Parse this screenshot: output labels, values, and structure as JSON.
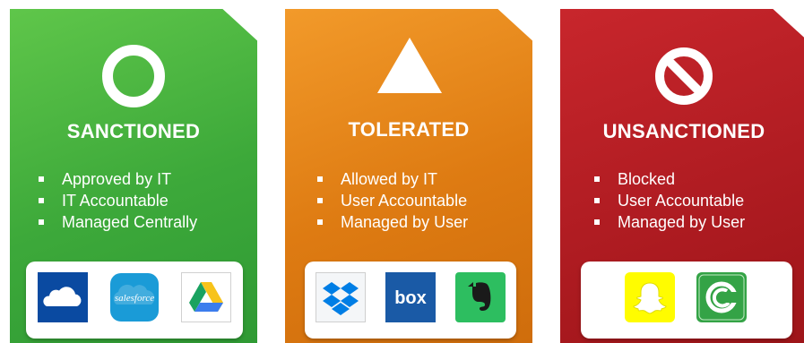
{
  "columns": [
    {
      "title": "SANCTIONED",
      "bullets": [
        "Approved by IT",
        "IT Accountable",
        "Managed Centrally"
      ],
      "color": "#3da93a",
      "symbol": "circle-icon",
      "apps": [
        {
          "icon": "onedrive-icon",
          "color": "#0a4aa1"
        },
        {
          "icon": "salesforce-icon",
          "color": "#1a9bd7",
          "label": "salesforce"
        },
        {
          "icon": "google-drive-icon",
          "color": "#ffffff"
        }
      ]
    },
    {
      "title": "TOLERATED",
      "bullets": [
        "Allowed by IT",
        "User Accountable",
        "Managed by User"
      ],
      "color": "#de7b12",
      "symbol": "triangle-icon",
      "apps": [
        {
          "icon": "dropbox-icon",
          "color": "#007ee5"
        },
        {
          "icon": "box-icon",
          "color": "#1a5aa6",
          "label": "box"
        },
        {
          "icon": "evernote-icon",
          "color": "#2dbe60"
        }
      ]
    },
    {
      "title": "UNSANCTIONED",
      "bullets": [
        "Blocked",
        "User Accountable",
        "Managed by User"
      ],
      "color": "#b01c22",
      "symbol": "prohibited-icon",
      "apps": [
        {
          "icon": "snapchat-icon",
          "color": "#fffc00"
        },
        {
          "icon": "bittorrent-icon",
          "color": "#34a346"
        }
      ]
    }
  ]
}
